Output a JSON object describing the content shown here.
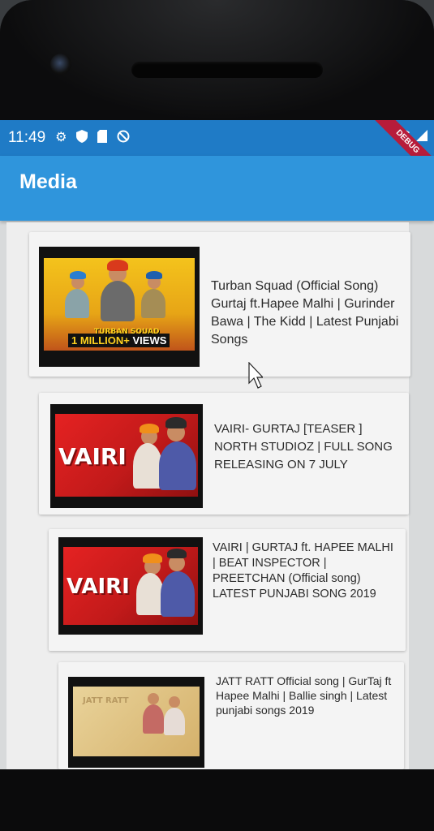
{
  "status_bar": {
    "time": "11:49",
    "icons": [
      "gear-icon",
      "shield-icon",
      "sd-card-icon",
      "circle-slash-icon"
    ],
    "right_icons": [
      "wifi-icon",
      "signal-icon"
    ],
    "debug_label": "DEBUG"
  },
  "app_bar": {
    "title": "Media",
    "color": "#2f95dc"
  },
  "videos": [
    {
      "title": "Turban Squad (Official Song) Gurtaj ft.Hapee Malhi | Gurinder Bawa | The Kidd | Latest Punjabi Songs",
      "thumb_text": "TURBAN SQUAD",
      "views_label_1": "1 MILLION+",
      "views_label_2": "VIEWS"
    },
    {
      "title": "VAIRI- GURTAJ [TEASER ] NORTH STUDIOZ | FULL SONG RELEASING ON 7 JULY",
      "thumb_text": "VAIRI"
    },
    {
      "title": "VAIRI | GURTAJ ft. HAPEE MALHI | BEAT INSPECTOR | PREETCHAN (Official song) LATEST PUNJABI SONG 2019",
      "thumb_text": "VAIRI"
    },
    {
      "title": "JATT RATT Official song | GurTaj ft Hapee Malhi | Ballie singh | Latest punjabi songs 2019",
      "thumb_text": "JATT RATT"
    }
  ]
}
